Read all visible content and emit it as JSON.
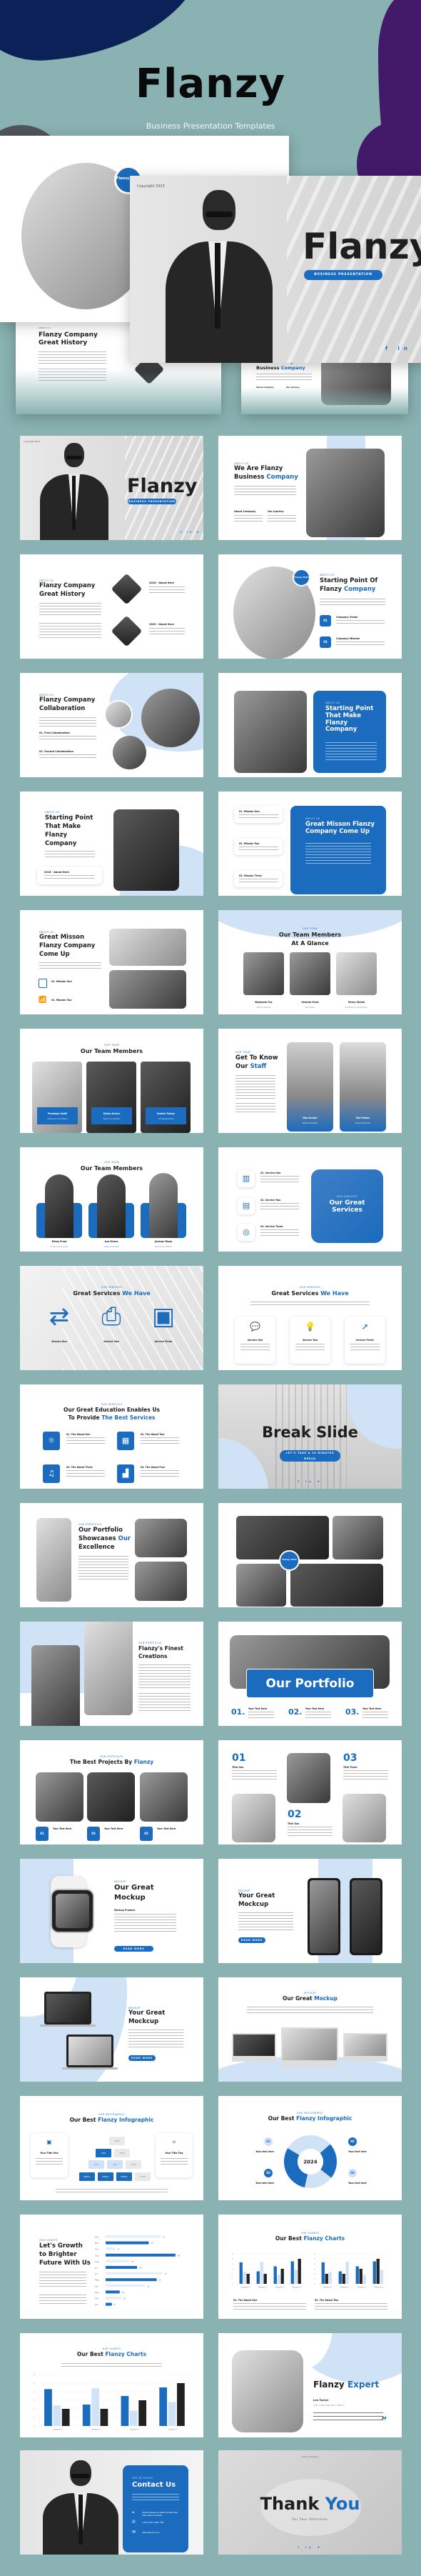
{
  "header": {
    "brand": "Flanzy",
    "tagline": "Business Presentation Templates"
  },
  "colors": {
    "background": "#8AB2B2",
    "accent": "#1B6BBE",
    "accent_light": "#CFE2F6",
    "navy_blob": "#0B2158",
    "purple_blob": "#43196A"
  },
  "hero": {
    "title_slide": {
      "copyright": "Copyright 2023",
      "title": "Flanzy",
      "pill": "BUSINESS PRESENTATION",
      "social": [
        "f",
        "in",
        "X"
      ]
    },
    "back_slide": {
      "badge": "Flanzy 2022",
      "tag": "ABOUT US"
    },
    "history_slide": {
      "tag": "ABOUT US",
      "title_dark": "Flanzy Company",
      "title_blue": "Great History",
      "item2": "2023 - About Here"
    },
    "company_slide": {
      "tag": "ABOUT US",
      "title_dark": "We Are Flanzy",
      "title_dark2": "Business",
      "title_blue": "Company",
      "col1": "About Company",
      "col2": "Our Journey"
    }
  },
  "slides": {
    "s1": {
      "copyright": "Copyright 2023",
      "title": "Flanzy",
      "pill": "BUSINESS PRESENTATION",
      "social": "f in X"
    },
    "s2": {
      "tag": "ABOUT US",
      "title1": "We Are Flanzy",
      "title2": "Business",
      "title_blue": "Company",
      "col1": "About Company",
      "col2": "Our Journey"
    },
    "s3": {
      "tag": "ABOUT US",
      "title1": "Flanzy Company",
      "title_blue": "Great History",
      "item1": "2018 - About Here",
      "item2": "2023 - About Here"
    },
    "s4": {
      "badge": "Flanzy 2022",
      "tag": "ABOUT US",
      "title1": "Starting Point Of",
      "title2": "Flanzy",
      "title_blue": "Company",
      "items": [
        {
          "n": "01",
          "label": "Company Vision"
        },
        {
          "n": "02",
          "label": "Company Mission"
        }
      ]
    },
    "s5": {
      "tag": "ABOUT US",
      "title1": "Flanzy Company",
      "title_blue": "Collaboration",
      "item1": "01. First Collaboration",
      "item2": "02. Second Collaboration"
    },
    "s6": {
      "tag": "ABOUT US",
      "title": "Starting Point That Make Flanzy Company"
    },
    "s7": {
      "tag": "ABOUT US",
      "title1": "Starting Point",
      "title2": "That Make",
      "title3": "Flanzy",
      "title_blue": "Company",
      "card": "2018 - About Here"
    },
    "s8": {
      "missions": [
        "01. Mission One",
        "02. Mission Two",
        "03. Mission Three"
      ],
      "tag": "ABOUT US",
      "title": "Great Misson Flanzy Company Come Up"
    },
    "s9": {
      "tag": "ABOUT US",
      "title1": "Great Misson",
      "title2": "Flanzy Company",
      "title_blue": "Come Up",
      "item1": "01. Mission One",
      "item2": "02. Mission Two"
    },
    "s10": {
      "tag": "OUR TEAM",
      "title1": "Our Team Members",
      "title2": "At A Glance",
      "members": [
        {
          "name": "Benjamin Fox",
          "role": "CEO & Owner"
        },
        {
          "name": "Victoria Frost",
          "role": "Recruiter"
        },
        {
          "name": "Henry Steele",
          "role": "Facilities Coordinator"
        }
      ]
    },
    "s11": {
      "tag": "OUR TEAM",
      "title": "Our Team Members",
      "members": [
        {
          "name": "Penelope Swift",
          "role": "Software Architect"
        },
        {
          "name": "Dylan Archer",
          "role": "Technical Writer"
        },
        {
          "name": "Hunter Falcon",
          "role": "UX Researcher"
        }
      ]
    },
    "s12": {
      "tag": "OUR TEAM",
      "title1": "Get To Know",
      "title2": "Our",
      "title_blue": "Staff",
      "members": [
        {
          "name": "Max Archer",
          "role": "Data Scientist"
        },
        {
          "name": "Zoe Parker",
          "role": "Event Planner"
        }
      ]
    },
    "s13": {
      "tag": "OUR TEAM",
      "title": "Our Team Members",
      "members": [
        {
          "name": "Ethan Frost",
          "role": "Financial Analyst"
        },
        {
          "name": "Ava Rivers",
          "role": "Data Scientist"
        },
        {
          "name": "Jackson Blaze",
          "role": "Technical Writer"
        }
      ]
    },
    "s14": {
      "services": [
        "01. Service One",
        "02. Service Two",
        "03. Service Three"
      ],
      "tag": "OUR SERVICES",
      "title": "Our Great Services"
    },
    "s15": {
      "tag": "OUR SERVICES",
      "title_dark": "Great Services",
      "title_blue": "We Have",
      "services": [
        "Service One",
        "Service Two",
        "Service Three"
      ]
    },
    "s16": {
      "tag": "OUR SERVICES",
      "title_dark": "Great Services",
      "title_blue": "We Have",
      "services": [
        "Service One",
        "Service Two",
        "Service Three"
      ]
    },
    "s17": {
      "tag": "OUR SERVICES",
      "title1": "Our Great Education Enables Us",
      "title2": "To Provide",
      "title_blue": "The Best Services",
      "items": [
        "01. The About One",
        "02. The About Two",
        "03. The About Three",
        "04. The About Four"
      ]
    },
    "s18": {
      "title": "Break Slide",
      "pill": "LET'S TAKE A 15 MINUTES BREAK",
      "social": "f in X"
    },
    "s19": {
      "tag": "OUR PORTFOLIO",
      "title1": "Our Portfolio",
      "title2": "Showcases",
      "title_blue2": "Our",
      "title_blue": "Excellence"
    },
    "s20": {
      "badge": "Flanzy 2023"
    },
    "s21": {
      "tag": "OUR PORTFOLIO",
      "title1": "Flanzy's Finest",
      "title_blue": "Creations"
    },
    "s22": {
      "title": "Our Portfolio",
      "items": [
        {
          "n": "01.",
          "label": "Your Text Here"
        },
        {
          "n": "02.",
          "label": "Your Text Here"
        },
        {
          "n": "03.",
          "label": "Your Text Here"
        }
      ]
    },
    "s23": {
      "tag": "OUR PORTFOLIO",
      "title_dark": "The Best Projects By",
      "title_blue": "Flanzy",
      "items": [
        {
          "n": "01",
          "label": "Your Text Here"
        },
        {
          "n": "02",
          "label": "Your Text Here"
        },
        {
          "n": "03",
          "label": "Your Text Here"
        }
      ]
    },
    "s24": {
      "items": [
        {
          "n": "01",
          "label": "Title One"
        },
        {
          "n": "02",
          "label": "Title Two"
        },
        {
          "n": "03",
          "label": "Title Three"
        }
      ]
    },
    "s25": {
      "tag": "MOCKUP",
      "title1": "Our Great",
      "title_blue": "Mockup",
      "sub": "Mockup Product",
      "button": "READ MORE"
    },
    "s26": {
      "tag": "MOCKUP",
      "title1": "Your Great",
      "title2": "Mockcup",
      "button": "READ MORE"
    },
    "s27": {
      "tag": "MOCKUP",
      "title1": "Your Great",
      "title_blue": "Mockcup",
      "button": "READ MORE"
    },
    "s28": {
      "tag": "MOCKUP",
      "title_dark": "Our Great",
      "title_blue": "Mockup"
    },
    "s29": {
      "tag": "OUR INFOGRAPHIC",
      "title_dark": "Our Best",
      "title_blue": "Flanzy Infographic",
      "card1": "Your Title One",
      "card2": "Your Title Two",
      "pyramid": [
        [
          "165K"
        ],
        [
          "12M",
          "250K"
        ],
        [
          "22M",
          "42M",
          "435K"
        ],
        [
          "500M+",
          "550M+",
          "550M+",
          "675K"
        ]
      ]
    },
    "s30": {
      "tag": "OUR INFOGRAPHIC",
      "title_dark": "Our Best",
      "title_blue": "Flanzy Infographic",
      "center": "2024",
      "labels": [
        "Your text here",
        "Your text here",
        "Your text here",
        "Your text here"
      ],
      "nums": [
        "01",
        "02",
        "03",
        "04"
      ]
    },
    "s31": {
      "tag": "OUR CHARTS",
      "title1": "Let's Growth",
      "title2": "to Brighter",
      "title_blue": "Future With Us"
    },
    "s32": {
      "tag": "OUR CHARTS",
      "title_dark": "Our Best",
      "title_blue": "Flanzy Charts",
      "item1": "01. The About One",
      "item2": "02. The About Two"
    },
    "s33": {
      "tag": "OUR CHARTS",
      "title_dark": "Our Best",
      "title_blue": "Flanzy Charts"
    },
    "s34": {
      "title_dark": "Flanzy",
      "title_blue": "Expert",
      "name": "Leo Turner",
      "role": "CEO (Chief Executive Officer)",
      "quote": "”"
    },
    "s35": {
      "tag": "GET IN TOUCH",
      "title": "Contact Us",
      "address": "330 Broadway Av New Canberra NA 2024 West Australia",
      "phone": "(+62) 8123 4567 789",
      "email": "ghity@email.com"
    },
    "s36": {
      "company": "Flanzy Company",
      "title_dark": "Thank",
      "title_blue": "You",
      "sub": "For Your Attention",
      "social": "f in X"
    }
  },
  "chart_data": [
    {
      "type": "bar",
      "orientation": "horizontal",
      "title": "Let's Growth to Brighter Future With Us",
      "categories": [
        "Dec",
        "Nov",
        "Oct",
        "Sep",
        "Aug",
        "Jul",
        "Jun",
        "May",
        "Apr",
        "Mar",
        "Feb",
        "Jan"
      ],
      "values": [
        70,
        55,
        12,
        89,
        30,
        40,
        72,
        65,
        50,
        18,
        20,
        8
      ],
      "highlighted": [
        "Nov",
        "Sep",
        "Jul",
        "May",
        "Mar",
        "Jan"
      ]
    },
    {
      "type": "bar",
      "title": "Our Best Flanzy Charts",
      "categories": [
        "Category 1",
        "Category 2",
        "Category 3",
        "Category 4"
      ],
      "series": [
        {
          "name": "Series 1",
          "values": [
            4.3,
            2.5,
            3.5,
            4.5
          ],
          "color": "#1B6BBE"
        },
        {
          "name": "Series 2",
          "values": [
            2.4,
            4.4,
            1.8,
            2.8
          ],
          "color": "#CFE2F6"
        },
        {
          "name": "Series 3",
          "values": [
            2,
            2,
            3,
            5
          ],
          "color": "#222222"
        }
      ],
      "ylim": [
        0,
        6
      ],
      "yticks": [
        0,
        1,
        2,
        3,
        4,
        5,
        6
      ]
    },
    {
      "type": "pie",
      "title": "Our Best Flanzy Infographic",
      "center_label": "2024",
      "labels": [
        "01",
        "02",
        "03",
        "04"
      ],
      "values": [
        30,
        22,
        30,
        18
      ]
    }
  ]
}
